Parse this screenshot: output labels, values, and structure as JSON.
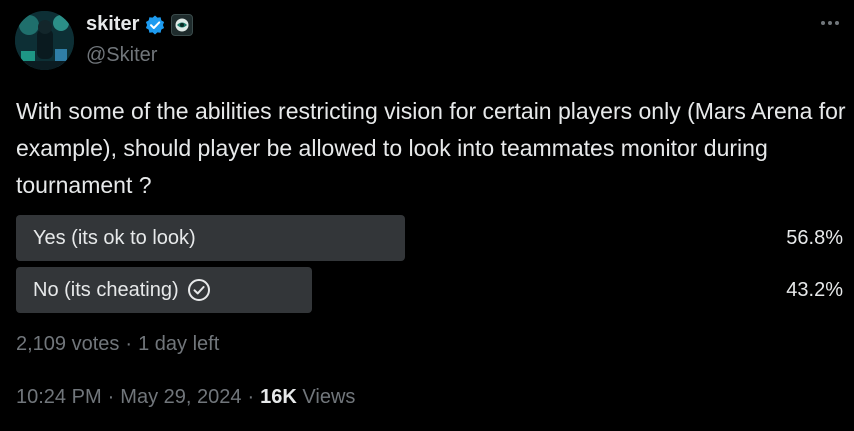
{
  "author": {
    "name": "skiter",
    "handle": "@Skiter"
  },
  "tweet": {
    "text": "With some of the abilities restricting vision for certain players only (Mars Arena for example), should player be allowed to look into teammates monitor during tournament ?"
  },
  "poll": {
    "options": [
      {
        "label": "Yes (its ok to look)",
        "percent_text": "56.8%",
        "percent": 56.8,
        "selected": false
      },
      {
        "label": "No (its cheating)",
        "percent_text": "43.2%",
        "percent": 43.2,
        "selected": true
      }
    ],
    "votes": "2,109 votes",
    "separator": "·",
    "time_left": "1 day left"
  },
  "meta": {
    "time": "10:24 PM",
    "separator": "·",
    "date": "May 29, 2024",
    "views_count": "16K",
    "views_label": "Views"
  },
  "colors": {
    "verified_blue": "#1d9bf0",
    "bar_fill": "#333639",
    "muted_text": "#71767b"
  },
  "icons": {
    "more": "more-icon",
    "verified": "verified-badge-icon",
    "affiliate": "affiliate-badge-icon",
    "selected": "check-circle-icon"
  }
}
